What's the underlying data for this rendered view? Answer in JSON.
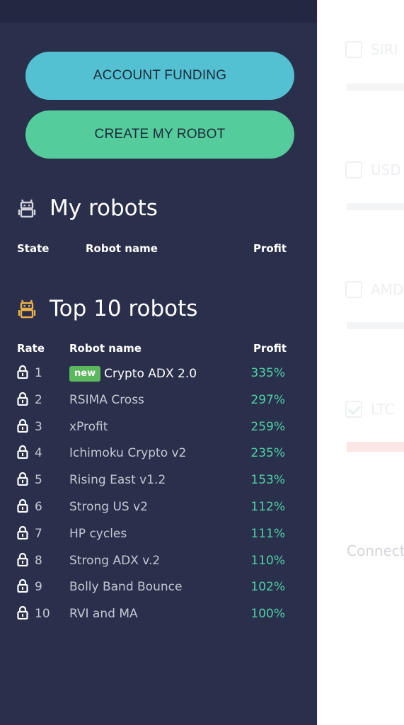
{
  "background": {
    "items": [
      {
        "label": "SIRI",
        "checked": false
      },
      {
        "label": "USD",
        "checked": false
      },
      {
        "label": "AMD",
        "checked": false
      },
      {
        "label": "LTC",
        "checked": true
      }
    ],
    "connect_label": "Connect"
  },
  "sidebar": {
    "funding_button": "ACCOUNT FUNDING",
    "create_button": "CREATE MY ROBOT",
    "my_robots": {
      "title": "My robots",
      "headers": {
        "state": "State",
        "name": "Robot name",
        "profit": "Profit"
      }
    },
    "top_robots": {
      "title": "Top 10 robots",
      "headers": {
        "rate": "Rate",
        "name": "Robot name",
        "profit": "Profit"
      },
      "rows": [
        {
          "rank": "1",
          "badge": "new",
          "name": "Crypto ADX 2.0",
          "profit": "335%"
        },
        {
          "rank": "2",
          "name": "RSIMA Cross",
          "profit": "297%"
        },
        {
          "rank": "3",
          "name": "xProfit",
          "profit": "259%"
        },
        {
          "rank": "4",
          "name": "Ichimoku Crypto v2",
          "profit": "235%"
        },
        {
          "rank": "5",
          "name": "Rising East v1.2",
          "profit": "153%"
        },
        {
          "rank": "6",
          "name": "Strong US v2",
          "profit": "112%"
        },
        {
          "rank": "7",
          "name": "HP cycles",
          "profit": "111%"
        },
        {
          "rank": "8",
          "name": "Strong ADX v.2",
          "profit": "110%"
        },
        {
          "rank": "9",
          "name": "Bolly Band Bounce",
          "profit": "102%"
        },
        {
          "rank": "10",
          "name": "RVI and MA",
          "profit": "100%"
        }
      ]
    }
  },
  "colors": {
    "sidebar_bg": "#2a2f4b",
    "funding_button": "#53c1d2",
    "create_button": "#55cc9b",
    "profit_text": "#4fd1a5",
    "new_badge": "#5cb85c",
    "top_robot_icon": "#e8b04a",
    "my_robot_icon": "#d0d3db"
  },
  "icons": {
    "my_robots": "robot-icon",
    "top_robots": "robot-icon",
    "row": "lock-icon"
  }
}
